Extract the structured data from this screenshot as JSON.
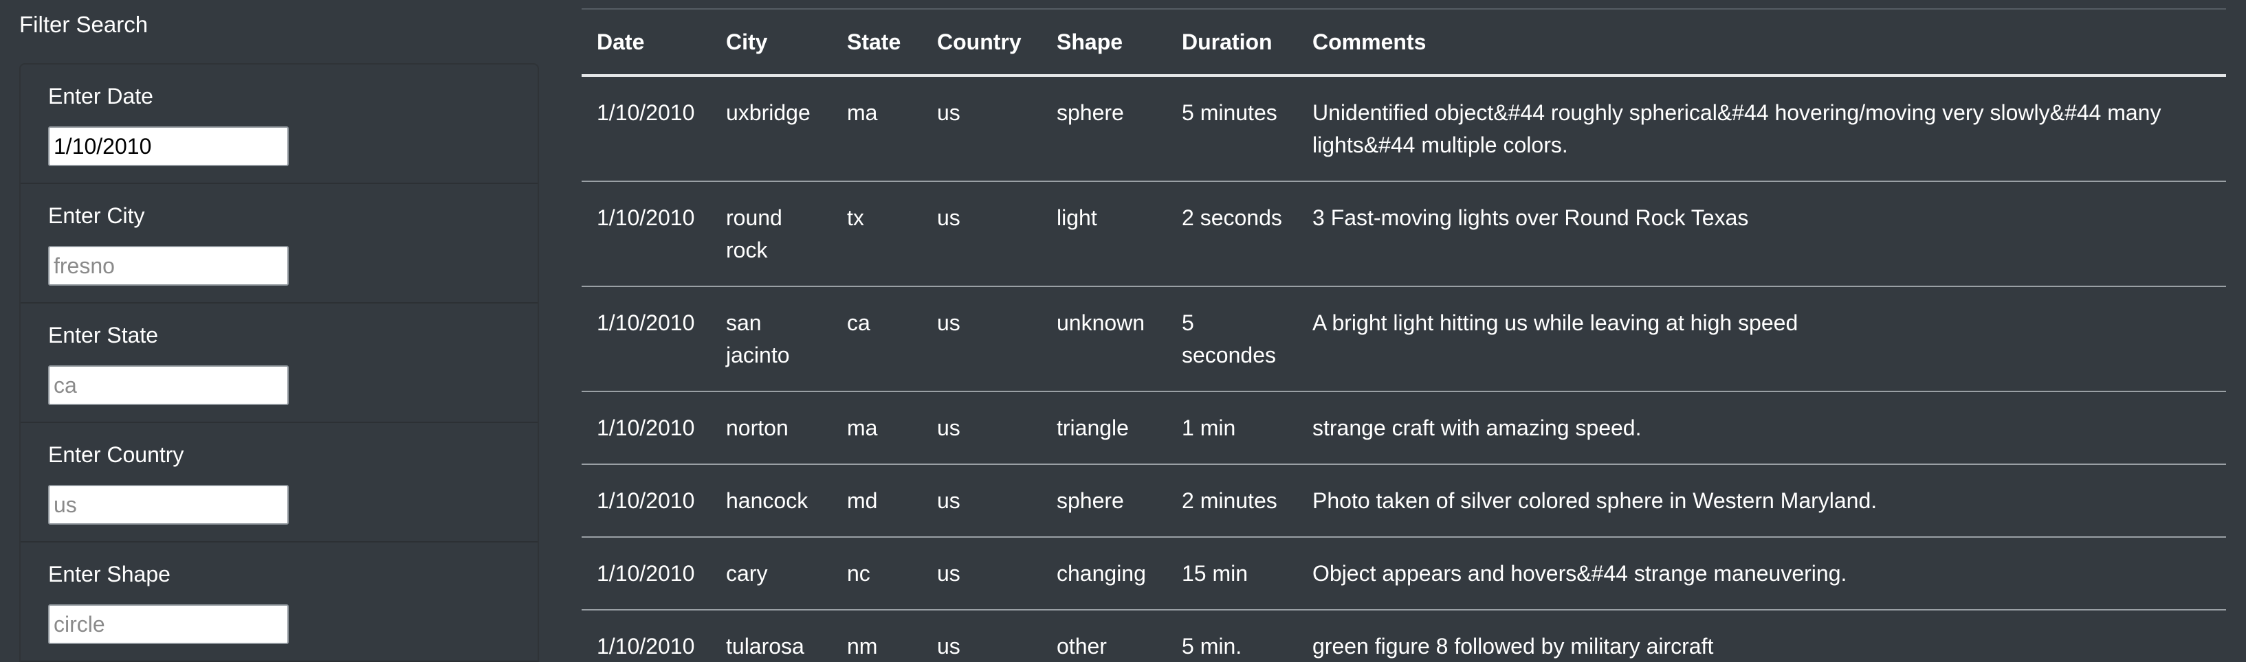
{
  "filter": {
    "title": "Filter Search",
    "fields": [
      {
        "label": "Enter Date",
        "value": "1/10/2010",
        "placeholder": ""
      },
      {
        "label": "Enter City",
        "value": "",
        "placeholder": "fresno"
      },
      {
        "label": "Enter State",
        "value": "",
        "placeholder": "ca"
      },
      {
        "label": "Enter Country",
        "value": "",
        "placeholder": "us"
      },
      {
        "label": "Enter Shape",
        "value": "",
        "placeholder": "circle"
      }
    ]
  },
  "table": {
    "headers": [
      "Date",
      "City",
      "State",
      "Country",
      "Shape",
      "Duration",
      "Comments"
    ],
    "rows": [
      [
        "1/10/2010",
        "uxbridge",
        "ma",
        "us",
        "sphere",
        "5 minutes",
        "Unidentified object&#44 roughly spherical&#44 hovering/moving very slowly&#44 many lights&#44 multiple colors."
      ],
      [
        "1/10/2010",
        "round rock",
        "tx",
        "us",
        "light",
        "2 seconds",
        "3 Fast-moving lights over Round Rock Texas"
      ],
      [
        "1/10/2010",
        "san jacinto",
        "ca",
        "us",
        "unknown",
        "5 secondes",
        "A bright light hitting us while leaving at high speed"
      ],
      [
        "1/10/2010",
        "norton",
        "ma",
        "us",
        "triangle",
        "1 min",
        "strange craft with amazing speed."
      ],
      [
        "1/10/2010",
        "hancock",
        "md",
        "us",
        "sphere",
        "2 minutes",
        "Photo taken of silver colored sphere in Western Maryland."
      ],
      [
        "1/10/2010",
        "cary",
        "nc",
        "us",
        "changing",
        "15 min",
        "Object appears and hovers&#44 strange maneuvering."
      ],
      [
        "1/10/2010",
        "tularosa",
        "nm",
        "us",
        "other",
        "5 min.",
        "green figure 8 followed by military aircraft"
      ]
    ]
  }
}
